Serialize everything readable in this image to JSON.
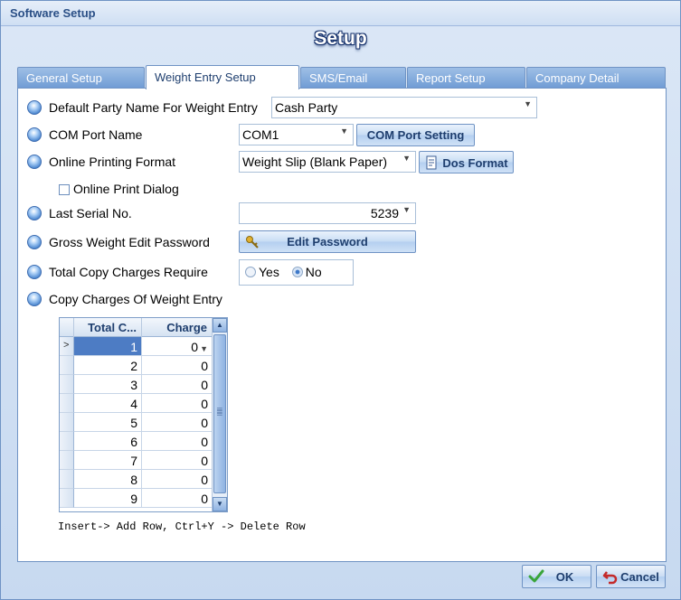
{
  "window": {
    "title": "Software Setup"
  },
  "header": {
    "title": "Setup"
  },
  "tabs": [
    {
      "label": "General Setup",
      "active": false
    },
    {
      "label": "Weight Entry Setup",
      "active": true
    },
    {
      "label": "SMS/Email",
      "active": false
    },
    {
      "label": "Report Setup",
      "active": false
    },
    {
      "label": "Company Detail",
      "active": false
    }
  ],
  "form": {
    "default_party": {
      "label": "Default Party Name For Weight Entry",
      "value": "Cash Party"
    },
    "com_port": {
      "label": "COM Port Name",
      "value": "COM1",
      "button": "COM Port Setting"
    },
    "online_printing": {
      "label": "Online Printing Format",
      "value": "Weight Slip (Blank Paper)",
      "button": "Dos Format"
    },
    "online_print_dialog": {
      "label": "Online Print Dialog",
      "checked": false
    },
    "last_serial": {
      "label": "Last Serial No.",
      "value": "5239"
    },
    "gross_weight_password": {
      "label": "Gross Weight Edit Password",
      "button": "Edit Password"
    },
    "total_copy_charges": {
      "label": "Total Copy Charges Require",
      "options": [
        "Yes",
        "No"
      ],
      "selected": "No"
    },
    "copy_charges": {
      "label": "Copy Charges Of Weight Entry"
    }
  },
  "grid": {
    "columns": [
      "Total C...",
      "Charge"
    ],
    "rows": [
      [
        "1",
        "0"
      ],
      [
        "2",
        "0"
      ],
      [
        "3",
        "0"
      ],
      [
        "4",
        "0"
      ],
      [
        "5",
        "0"
      ],
      [
        "6",
        "0"
      ],
      [
        "7",
        "0"
      ],
      [
        "8",
        "0"
      ],
      [
        "9",
        "0"
      ]
    ],
    "current_row_marker": ">"
  },
  "hint": "Insert-> Add Row, Ctrl+Y -> Delete Row",
  "footer": {
    "ok": "OK",
    "cancel": "Cancel"
  },
  "icons": {
    "ok": "checkmark-icon",
    "cancel": "undo-arrow-icon",
    "edit_password": "key-icon",
    "dos_format": "document-icon"
  },
  "colors": {
    "accent": "#4d7cc4",
    "tab": "#7aa3d8",
    "border": "#6f93c4"
  }
}
